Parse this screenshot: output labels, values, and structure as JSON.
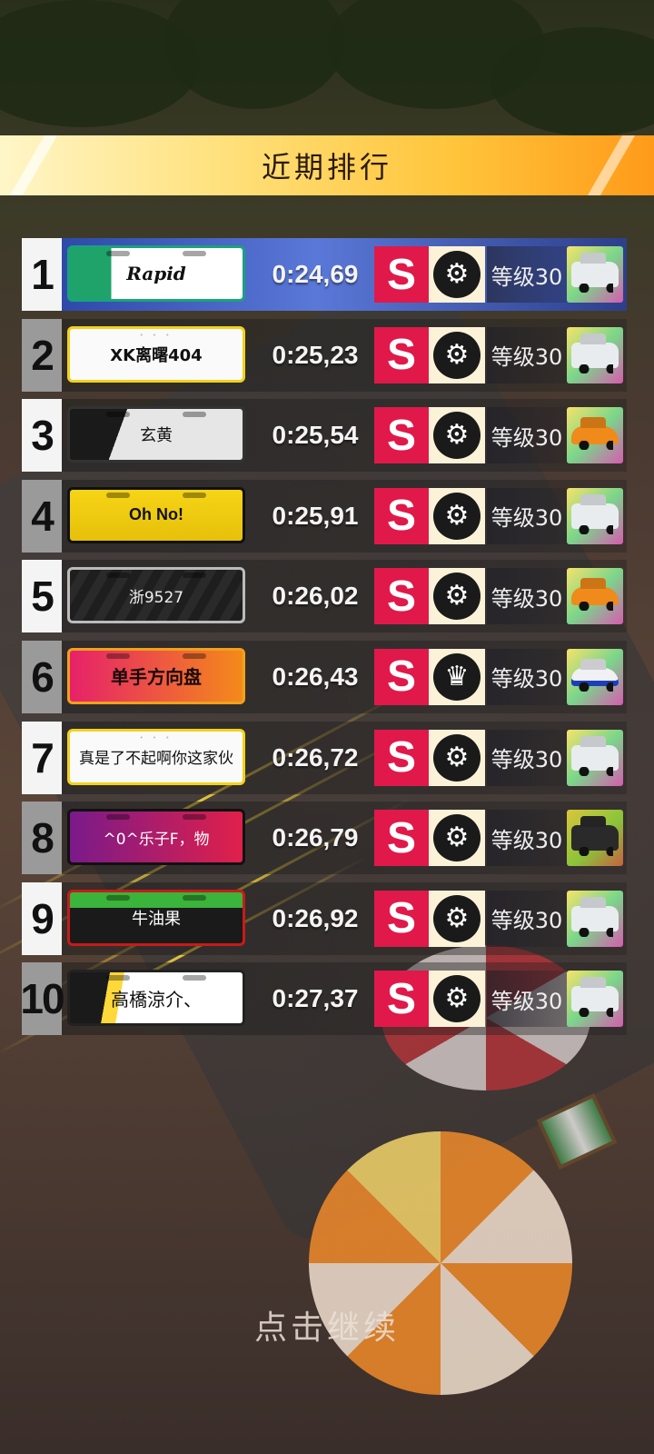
{
  "header": {
    "title": "近期排行"
  },
  "leaderboard": [
    {
      "rank": "1",
      "plate": "Rapid",
      "plate_style": "green",
      "time": "0:24,69",
      "grade": "S",
      "part_icon": "wheel-icon",
      "level": "等级30",
      "car": "jeep"
    },
    {
      "rank": "2",
      "plate": "XK离曙404",
      "plate_style": "welcome-yellow",
      "time": "0:25,23",
      "grade": "S",
      "part_icon": "wheel-icon",
      "level": "等级30",
      "car": "jeep"
    },
    {
      "rank": "3",
      "plate": "玄黄",
      "plate_style": "graffiti",
      "time": "0:25,54",
      "grade": "S",
      "part_icon": "wheel-icon",
      "level": "等级30",
      "car": "lambo"
    },
    {
      "rank": "4",
      "plate": "Oh No!",
      "plate_style": "yellow-black",
      "time": "0:25,91",
      "grade": "S",
      "part_icon": "wheel-icon",
      "level": "等级30",
      "car": "jeep"
    },
    {
      "rank": "5",
      "plate": "浙9527",
      "plate_style": "dark-stripe",
      "time": "0:26,02",
      "grade": "S",
      "part_icon": "wheel-icon",
      "level": "等级30",
      "car": "lambo"
    },
    {
      "rank": "6",
      "plate": "单手方向盘",
      "plate_style": "neon",
      "time": "0:26,43",
      "grade": "S",
      "part_icon": "crown-icon",
      "level": "等级30",
      "car": "race"
    },
    {
      "rank": "7",
      "plate": "真是了不起啊你这家伙",
      "plate_style": "welcome-white",
      "time": "0:26,72",
      "grade": "S",
      "part_icon": "wheel-icon",
      "level": "等级30",
      "car": "jeep"
    },
    {
      "rank": "8",
      "plate": "^0^乐子F，物",
      "plate_style": "pink-chevron",
      "time": "0:26,79",
      "grade": "S",
      "part_icon": "wheel-icon",
      "level": "等级30",
      "car": "truck"
    },
    {
      "rank": "9",
      "plate": "牛油果",
      "plate_style": "slime",
      "time": "0:26,92",
      "grade": "S",
      "part_icon": "wheel-icon",
      "level": "等级30",
      "car": "jeep"
    },
    {
      "rank": "10",
      "plate": "高橋涼介、",
      "plate_style": "police",
      "time": "0:27,37",
      "grade": "S",
      "part_icon": "wheel-icon",
      "level": "等级30",
      "car": "jeep"
    }
  ],
  "footer": {
    "continue_label": "点击继续"
  }
}
